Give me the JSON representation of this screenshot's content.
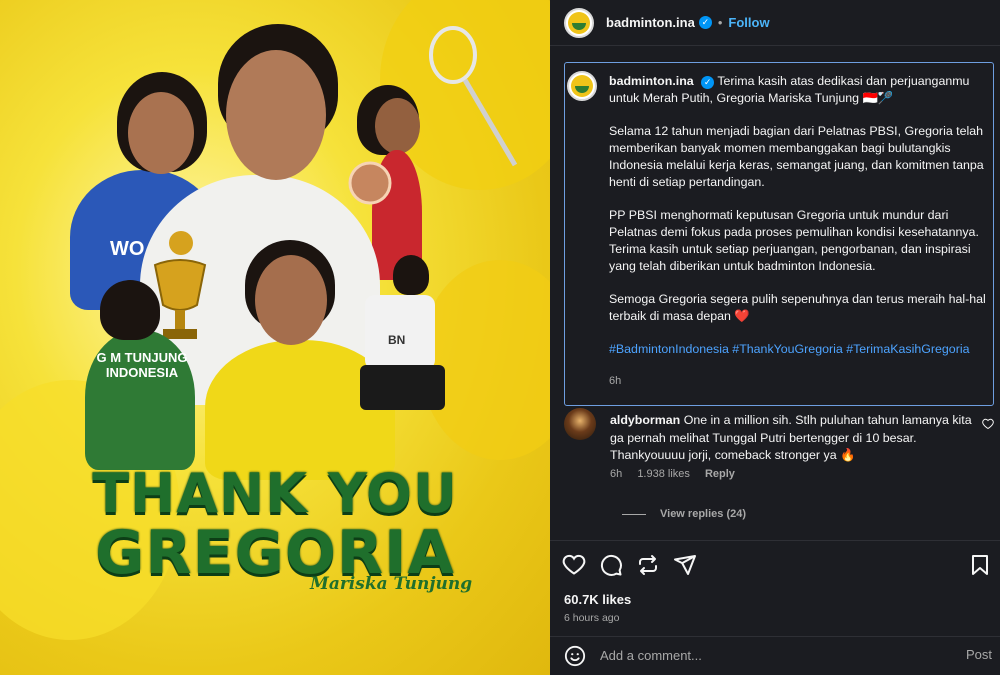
{
  "image": {
    "title_line1": "THANK YOU",
    "title_line2": "GREGORIA",
    "signature": "Mariska Tunjung",
    "jersey_text": "G M TUNJUNG\nINDONESIA",
    "jersey_top": "WO",
    "jersey_sponsor": "BN",
    "colors": {
      "background": "#f4d521",
      "title_green": "#1f6f2c"
    }
  },
  "header": {
    "username": "badminton.ina",
    "separator": "•",
    "follow_label": "Follow",
    "more_icon": "more-horizontal-icon"
  },
  "caption": {
    "username": "badminton.ina",
    "paragraphs": [
      "Terima kasih atas dedikasi dan perjuanganmu untuk Merah Putih, Gregoria Mariska Tunjung 🇮🇩🏸",
      "Selama 12 tahun menjadi bagian dari Pelatnas PBSI, Gregoria telah memberikan banyak momen membanggakan bagi bulutangkis Indonesia melalui kerja keras, semangat juang, dan komitmen tanpa henti di setiap pertandingan.",
      "PP PBSI menghormati keputusan Gregoria untuk mundur dari Pelatnas demi fokus pada proses pemulihan kondisi kesehatannya. Terima kasih untuk setiap perjuangan, pengorbanan, dan inspirasi yang telah diberikan untuk badminton Indonesia.",
      "Semoga Gregoria segera pulih sepenuhnya dan terus meraih hal-hal terbaik di masa depan ❤️"
    ],
    "hashtags": "#BadmintonIndonesia #ThankYouGregoria #TerimaKasihGregoria",
    "time": "6h"
  },
  "comment": {
    "username": "aldyborman",
    "text": "One in a million sih. Stlh puluhan tahun lamanya kita ga pernah melihat Tunggal Putri bertengger di 10 besar. Thankyouuuu jorji, comeback stronger ya 🔥",
    "time": "6h",
    "likes": "1.938 likes",
    "reply_label": "Reply",
    "view_replies": "View replies (24)"
  },
  "footer": {
    "likes": "60.7K likes",
    "posted": "6 hours ago",
    "add_comment_placeholder": "Add a comment...",
    "post_label": "Post"
  },
  "colors": {
    "panel_bg": "#1b1c21",
    "link_blue": "#4cb5f9",
    "hashtag_blue": "#4da3ff",
    "muted": "#a8a8a8",
    "caption_border": "#6e9ee0"
  }
}
